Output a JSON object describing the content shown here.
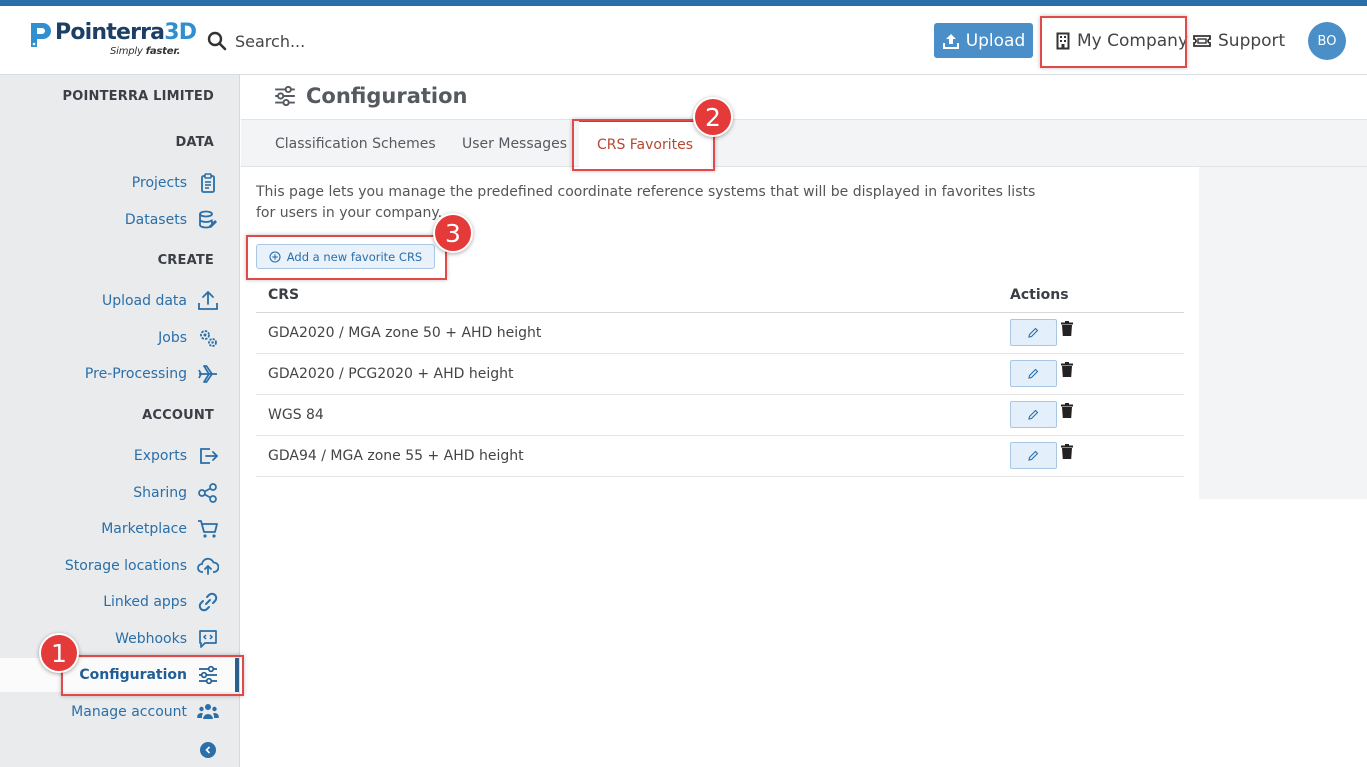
{
  "brand": {
    "name_main": "Pointerra",
    "name_accent": "3D",
    "tagline_plain": "Simply",
    "tagline_bold": "faster."
  },
  "header": {
    "search_placeholder": "Search...",
    "upload_label": "Upload",
    "company_label": "My Company",
    "support_label": "Support",
    "avatar_initials": "BO"
  },
  "sidebar": {
    "company_name": "POINTERRA LIMITED",
    "sections": {
      "data": "DATA",
      "create": "CREATE",
      "account": "ACCOUNT"
    },
    "items": {
      "projects": "Projects",
      "datasets": "Datasets",
      "upload_data": "Upload data",
      "jobs": "Jobs",
      "preprocessing": "Pre-Processing",
      "exports": "Exports",
      "sharing": "Sharing",
      "marketplace": "Marketplace",
      "storage_locations": "Storage locations",
      "linked_apps": "Linked apps",
      "webhooks": "Webhooks",
      "configuration": "Configuration",
      "manage_account": "Manage account"
    }
  },
  "page": {
    "title": "Configuration",
    "tabs": [
      "Classification Schemes",
      "User Messages",
      "CRS Favorites"
    ],
    "active_tab": "CRS Favorites",
    "description": "This page lets you manage the predefined coordinate reference systems that will be displayed in favorites lists for users in your company.",
    "add_button": "Add a new favorite CRS",
    "table": {
      "headers": {
        "crs": "CRS",
        "actions": "Actions"
      },
      "rows": [
        "GDA2020 / MGA zone 50 + AHD height",
        "GDA2020 / PCG2020 + AHD height",
        "WGS 84",
        "GDA94 / MGA zone 55 + AHD height"
      ]
    }
  },
  "annotations": {
    "badge1": "1",
    "badge2": "2",
    "badge3": "3"
  },
  "colors": {
    "accent_blue": "#2a6fa8",
    "button_blue": "#4a8fc7",
    "active_tab": "#b9472e",
    "highlight_red": "#e04a4a"
  }
}
